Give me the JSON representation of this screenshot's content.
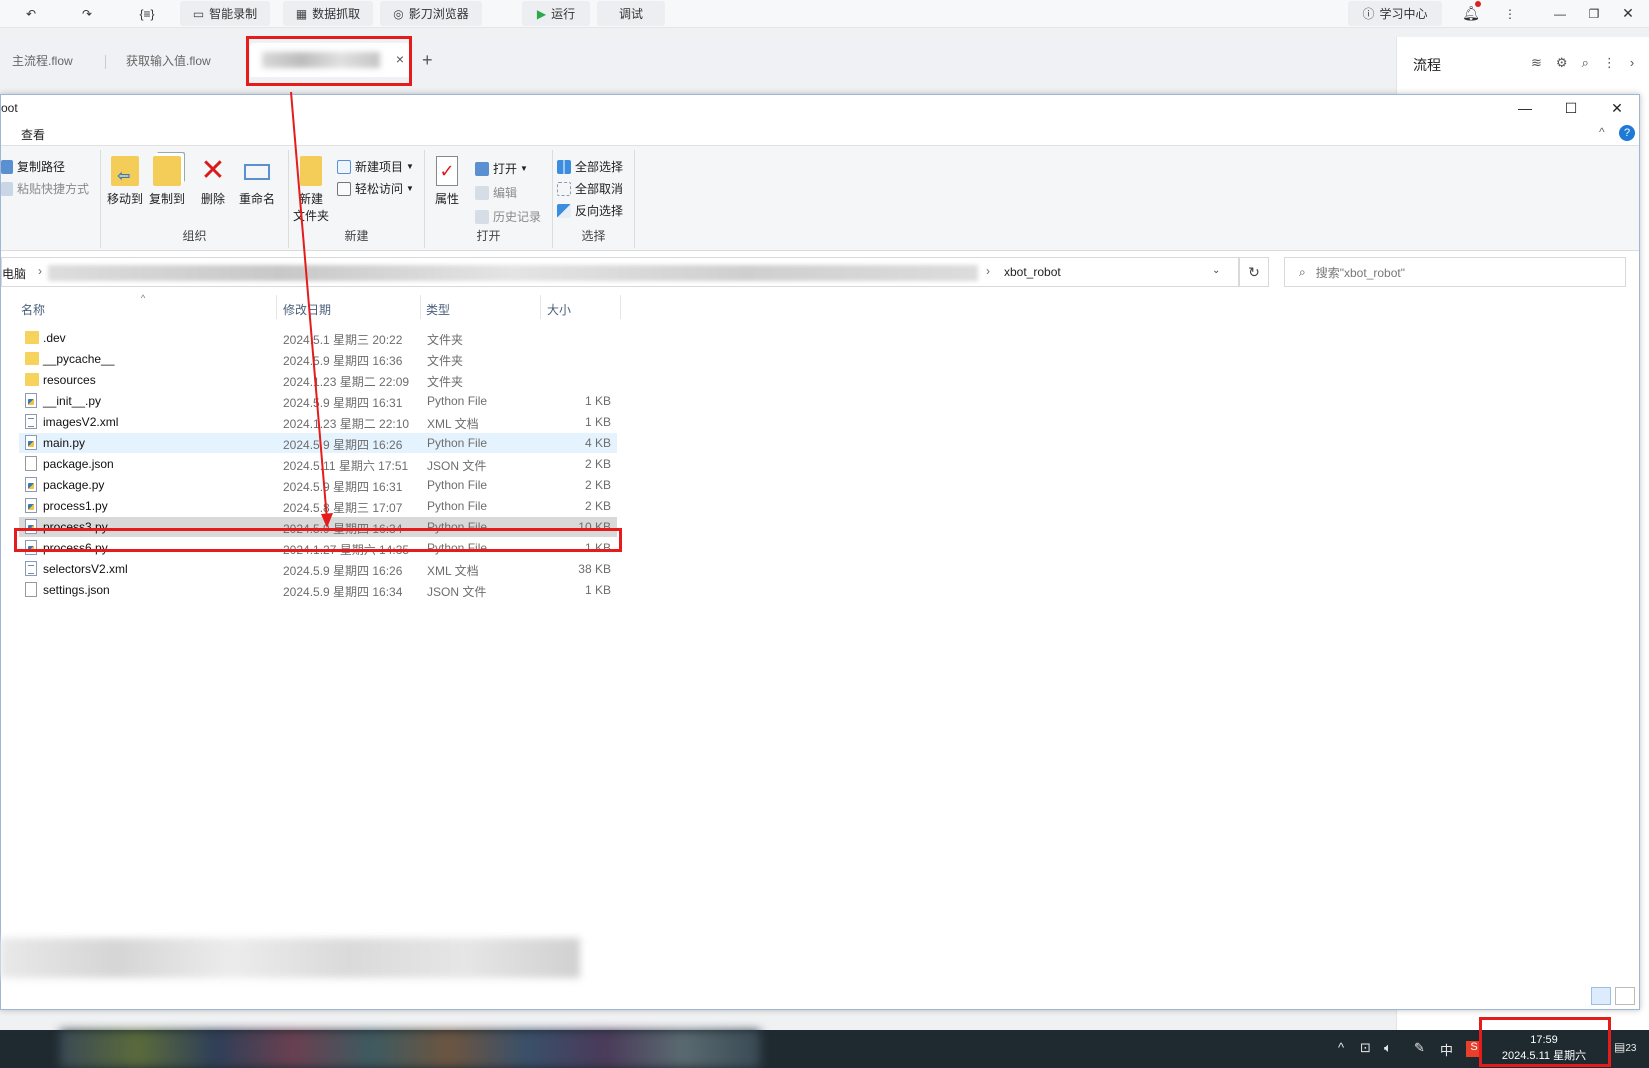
{
  "toolbar": {
    "undo_icon": "undo-icon",
    "redo_icon": "redo-icon",
    "braces": "{≡}",
    "smart_record": "智能录制",
    "data_capture": "数据抓取",
    "browser": "影刀浏览器",
    "run": "运行",
    "debug": "调试",
    "learning_center": "学习中心"
  },
  "tabs": [
    {
      "label": "主流程.flow"
    },
    {
      "label": "获取输入值.flow"
    },
    {
      "label": "",
      "close": "×"
    }
  ],
  "add_tab": "+",
  "right_panel": {
    "title": "流程"
  },
  "explorer": {
    "title": "oot",
    "menu": "查看",
    "ribbon": {
      "clipboard": {
        "copy_path": "复制路径",
        "paste_shortcut": "粘贴快捷方式"
      },
      "organize": {
        "label": "组织",
        "move_to": "移动到",
        "copy_to": "复制到",
        "delete": "删除",
        "rename": "重命名"
      },
      "new": {
        "label": "新建",
        "new_folder_1": "新建",
        "new_folder_2": "文件夹",
        "new_item": "新建项目",
        "easy_access": "轻松访问"
      },
      "open": {
        "label": "打开",
        "properties": "属性",
        "open": "打开",
        "edit": "编辑",
        "history": "历史记录"
      },
      "select": {
        "label": "选择",
        "select_all": "全部选择",
        "select_none": "全部取消",
        "invert": "反向选择"
      }
    },
    "address": {
      "root": "电脑",
      "current": "xbot_robot"
    },
    "search_placeholder": "搜索\"xbot_robot\"",
    "columns": {
      "name": "名称",
      "date": "修改日期",
      "type": "类型",
      "size": "大小"
    },
    "files": [
      {
        "name": ".dev",
        "date": "2024.5.1 星期三 20:22",
        "type": "文件夹",
        "size": "",
        "icon": "folder"
      },
      {
        "name": "__pycache__",
        "date": "2024.5.9 星期四 16:36",
        "type": "文件夹",
        "size": "",
        "icon": "folder"
      },
      {
        "name": "resources",
        "date": "2024.1.23 星期二 22:09",
        "type": "文件夹",
        "size": "",
        "icon": "folder"
      },
      {
        "name": "__init__.py",
        "date": "2024.5.9 星期四 16:31",
        "type": "Python File",
        "size": "1 KB",
        "icon": "py"
      },
      {
        "name": "imagesV2.xml",
        "date": "2024.1.23 星期二 22:10",
        "type": "XML 文档",
        "size": "1 KB",
        "icon": "xml"
      },
      {
        "name": "main.py",
        "date": "2024.5.9 星期四 16:26",
        "type": "Python File",
        "size": "4 KB",
        "icon": "py"
      },
      {
        "name": "package.json",
        "date": "2024.5.11 星期六 17:51",
        "type": "JSON 文件",
        "size": "2 KB",
        "icon": "json"
      },
      {
        "name": "package.py",
        "date": "2024.5.9 星期四 16:31",
        "type": "Python File",
        "size": "2 KB",
        "icon": "py"
      },
      {
        "name": "process1.py",
        "date": "2024.5.8 星期三 17:07",
        "type": "Python File",
        "size": "2 KB",
        "icon": "py"
      },
      {
        "name": "process3.py",
        "date": "2024.5.9 星期四 16:34",
        "type": "Python File",
        "size": "10 KB",
        "icon": "py"
      },
      {
        "name": "process6.py",
        "date": "2024.1.27 星期六 14:35",
        "type": "Python File",
        "size": "1 KB",
        "icon": "py"
      },
      {
        "name": "selectorsV2.xml",
        "date": "2024.5.9 星期四 16:26",
        "type": "XML 文档",
        "size": "38 KB",
        "icon": "xml"
      },
      {
        "name": "settings.json",
        "date": "2024.5.9 星期四 16:34",
        "type": "JSON 文件",
        "size": "1 KB",
        "icon": "json"
      }
    ]
  },
  "taskbar": {
    "ime": "中",
    "time": "17:59",
    "date": "2024.5.11 星期六",
    "notifications": "23"
  },
  "colors": {
    "annotation": "#e51c1c",
    "accent": "#2b7bd3"
  }
}
